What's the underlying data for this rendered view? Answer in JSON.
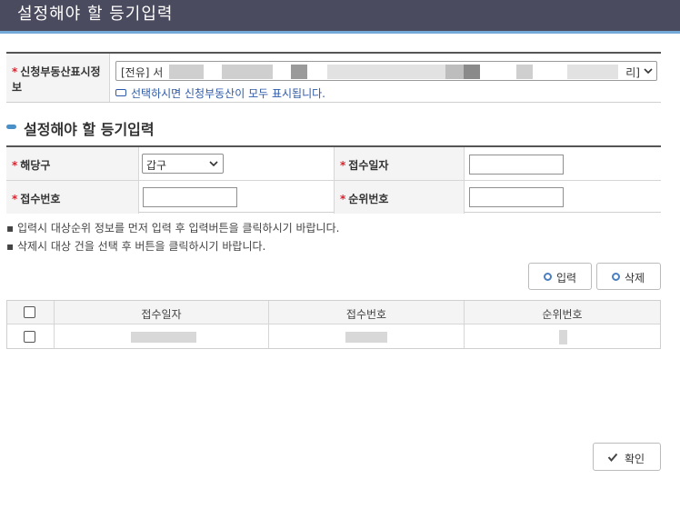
{
  "window": {
    "title": "설정해야 할 등기입력"
  },
  "property": {
    "label": "신청부동산표시정보",
    "selected_prefix": "[전유] 서",
    "selected_suffix": "리]",
    "hint": "선택하시면 신청부동산이 모두 표시됩니다."
  },
  "section": {
    "title": "설정해야 할 등기입력"
  },
  "form": {
    "section_label": "해당구",
    "section_value": "갑구",
    "receipt_date_label": "접수일자",
    "receipt_date_value": "",
    "receipt_no_label": "접수번호",
    "receipt_no_value": "",
    "rank_no_label": "순위번호",
    "rank_no_value": ""
  },
  "notes": [
    "입력시 대상순위 정보를 먼저 입력 후 입력버튼을 클릭하시기 바랍니다.",
    "삭제시 대상 건을 선택 후 버튼을 클릭하시기 바랍니다."
  ],
  "buttons": {
    "input": "입력",
    "delete": "삭제",
    "confirm": "확인"
  },
  "grid": {
    "columns": [
      "접수일자",
      "접수번호",
      "순위번호"
    ],
    "rows": [
      {
        "checked": false
      }
    ]
  },
  "colors": {
    "title_bar": "#4b4b5f",
    "accent": "#74a8d6",
    "required": "#d9232e",
    "link": "#2d5aa8"
  },
  "icons": [
    "select-chevron-icon",
    "arrow-hint-icon",
    "circle-icon",
    "check-icon"
  ]
}
